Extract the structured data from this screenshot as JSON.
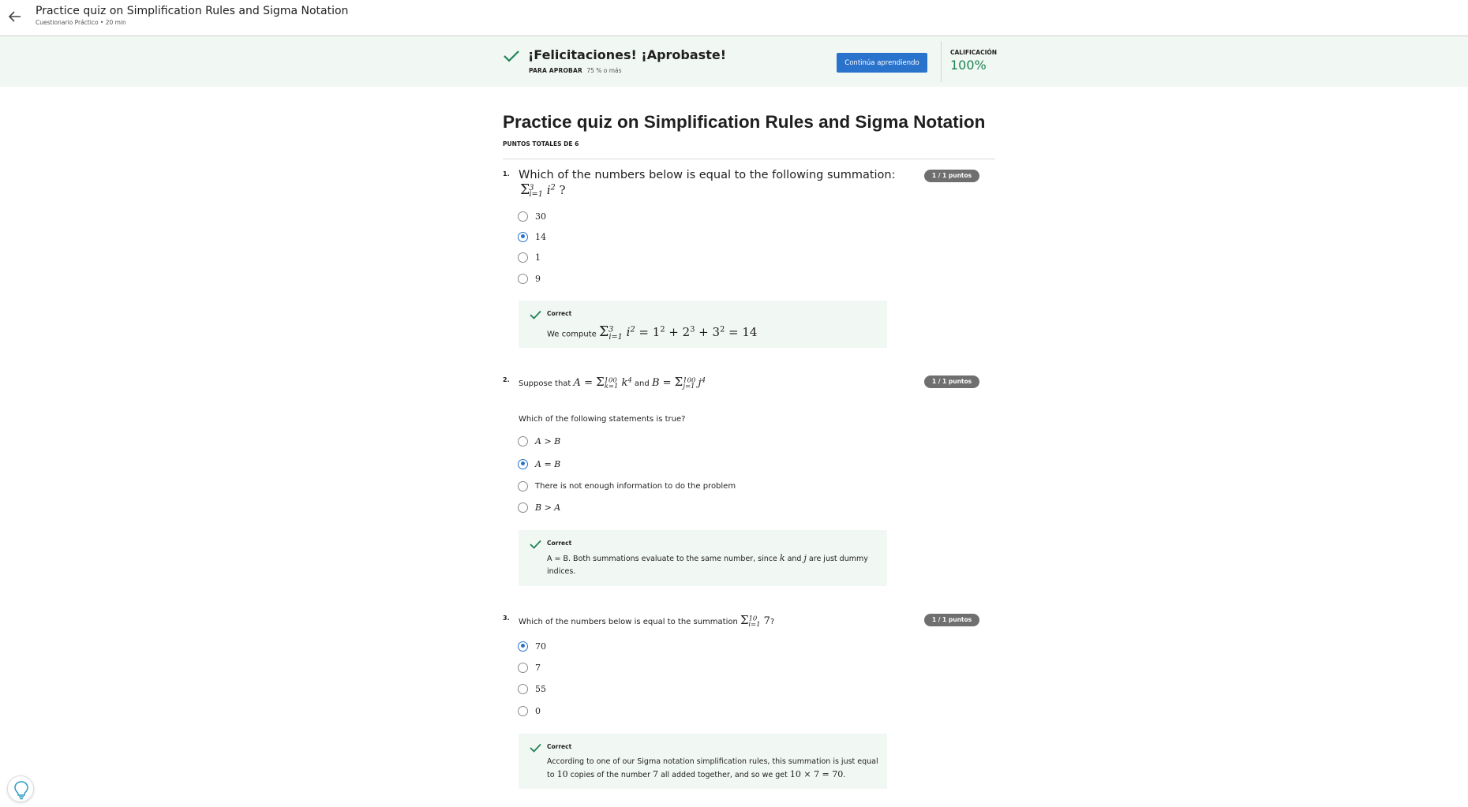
{
  "topbar": {
    "title": "Practice quiz on Simplification Rules and Sigma Notation",
    "subtitle": "Cuestionario Práctico • 20 min",
    "back_icon": "arrow-left-icon"
  },
  "banner": {
    "title": "¡Felicitaciones! ¡Aprobaste!",
    "pass_label": "PARA APROBAR",
    "pass_value": "75 % o más",
    "continue_label": "Continúa aprendiendo",
    "grade_label": "CALIFICACIÓN",
    "grade_value": "100%",
    "accent_color": "#1f8354",
    "button_color": "#2a73cc"
  },
  "quiz": {
    "title": "Practice quiz on Simplification Rules and Sigma Notation",
    "total_points": "PUNTOS TOTALES DE 6"
  },
  "questions": [
    {
      "number": "1.",
      "points": "1 / 1 puntos",
      "text": "Which of the numbers below is equal to the following summation:",
      "options": [
        "30",
        "14",
        "1",
        "9"
      ],
      "selected_index": 1,
      "feedback_title": "Correct",
      "feedback_text": "We compute"
    },
    {
      "number": "2.",
      "points": "1 / 1 puntos",
      "text_prefix": "Suppose that",
      "text_and": "and",
      "subtext": "Which of the following statements is true?",
      "options": [
        "A > B",
        "A = B",
        "There is not enough information to do the problem",
        "B > A"
      ],
      "selected_index": 1,
      "feedback_title": "Correct",
      "feedback_text_a": "A = B. Both summations evaluate to the same number, since",
      "feedback_text_and": "and",
      "feedback_text_b": "are just dummy indices."
    },
    {
      "number": "3.",
      "points": "1 / 1 puntos",
      "text": "Which of the numbers below is equal to the summation",
      "options": [
        "70",
        "7",
        "55",
        "0"
      ],
      "selected_index": 0,
      "feedback_title": "Correct",
      "feedback_text_a": "According to one of our Sigma notation simplification rules, this summation is just equal to",
      "feedback_text_b": "copies of the number",
      "feedback_text_c": "all added together, and so we get"
    }
  ],
  "hint_icon": "lightbulb-icon"
}
